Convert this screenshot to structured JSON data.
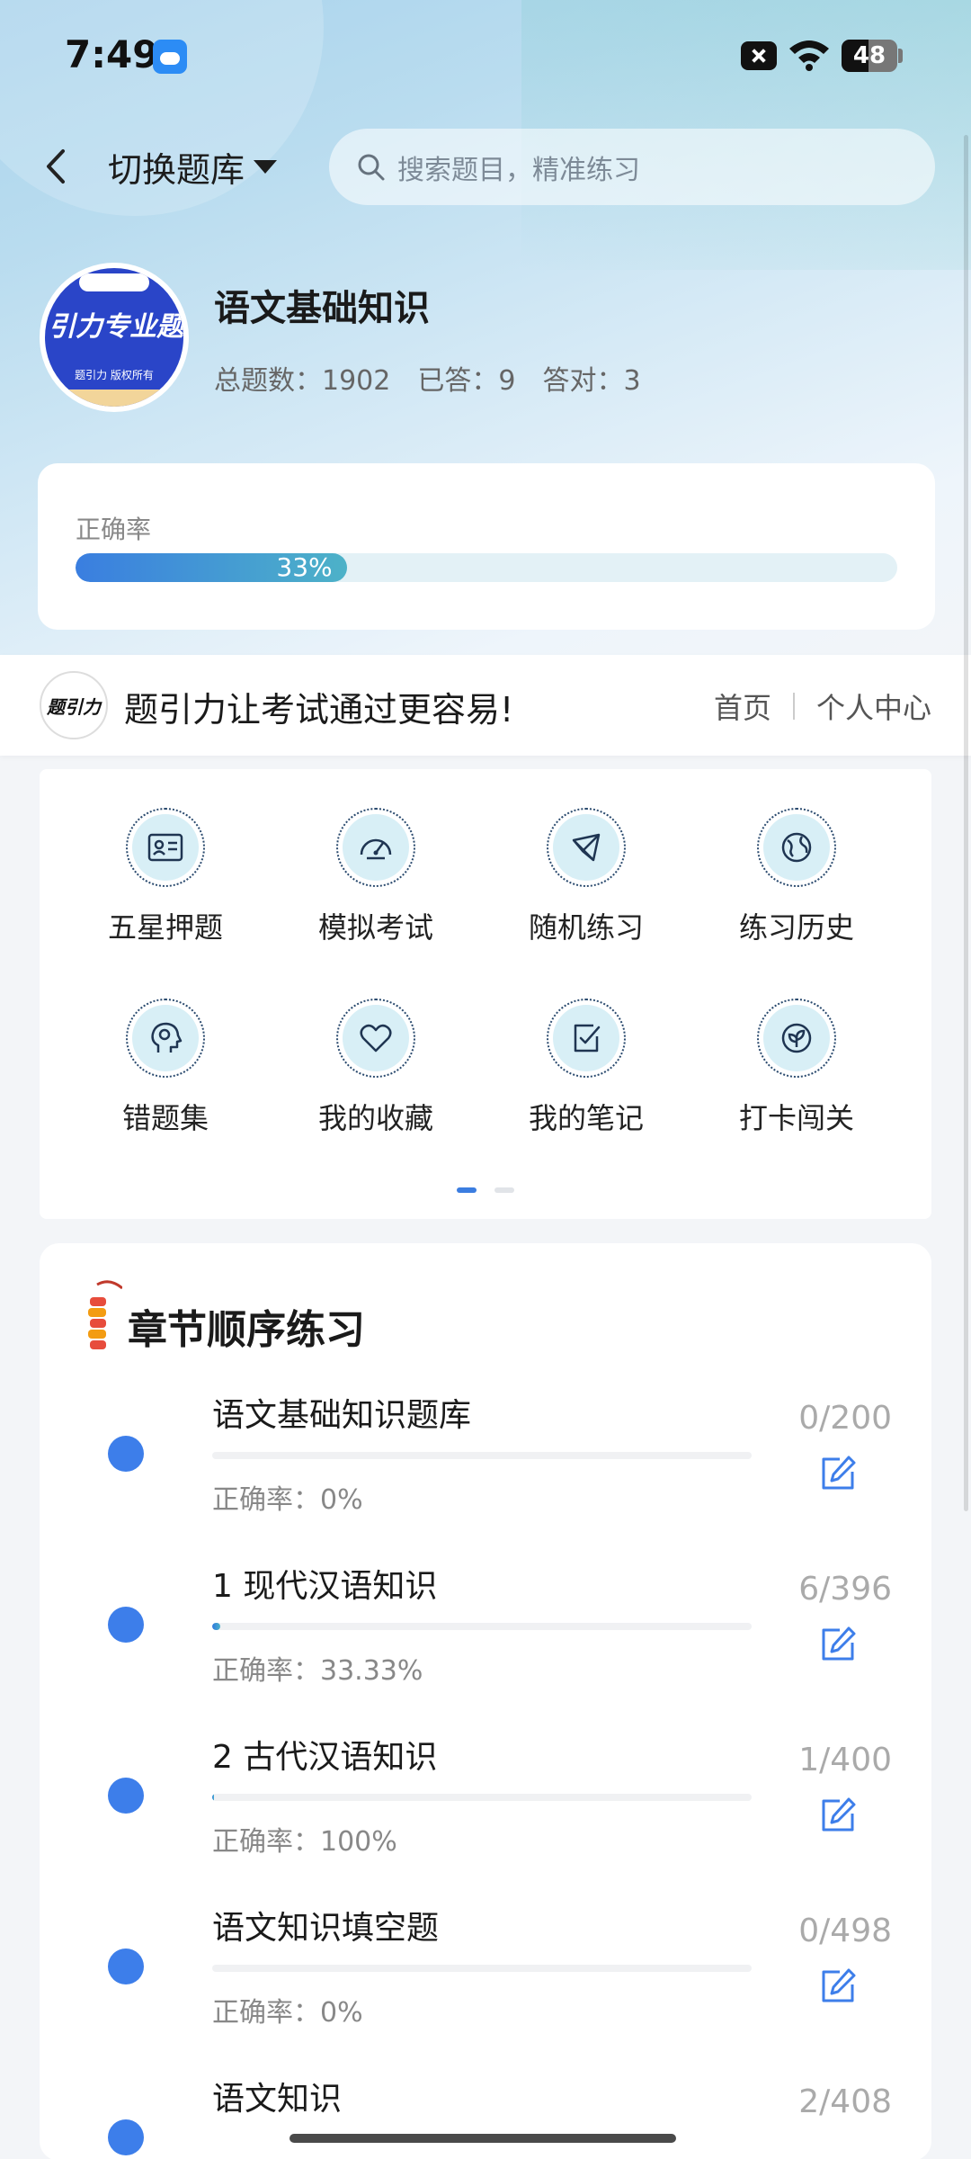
{
  "status_bar": {
    "time": "7:49",
    "battery": "48"
  },
  "header": {
    "switch_label": "切换题库",
    "search_placeholder": "搜索题目，精准练习"
  },
  "bank": {
    "logo_title": "引力专业题",
    "logo_subtitle": "题引力 版权所有",
    "logo_pill": "题引力",
    "title": "语文基础知识",
    "total": "总题数：1902",
    "answered": "已答：9",
    "correct": "答对：3"
  },
  "accuracy": {
    "label": "正确率",
    "value_text": "33%",
    "value": 0.33
  },
  "slogan": {
    "logo_text": "题引力",
    "text": "题引力让考试通过更容易!",
    "nav_home": "首页",
    "nav_profile": "个人中心"
  },
  "features": [
    {
      "label": "五星押题",
      "icon": "id-card-icon"
    },
    {
      "label": "模拟考试",
      "icon": "gauge-icon"
    },
    {
      "label": "随机练习",
      "icon": "shuffle-icon"
    },
    {
      "label": "练习历史",
      "icon": "globe-icon"
    },
    {
      "label": "错题集",
      "icon": "head-icon"
    },
    {
      "label": "我的收藏",
      "icon": "heart-icon"
    },
    {
      "label": "我的笔记",
      "icon": "note-check-icon"
    },
    {
      "label": "打卡闯关",
      "icon": "leaf-badge-icon"
    }
  ],
  "chapters": {
    "title": "章节顺序练习",
    "items": [
      {
        "name": "语文基础知识题库",
        "accuracy": "正确率：0%",
        "count": "0/200",
        "progress": 0.0
      },
      {
        "name": "1 现代汉语知识",
        "accuracy": "正确率：33.33%",
        "count": "6/396",
        "progress": 0.015
      },
      {
        "name": "2 古代汉语知识",
        "accuracy": "正确率：100%",
        "count": "1/400",
        "progress": 0.0025
      },
      {
        "name": "语文知识填空题",
        "accuracy": "正确率：0%",
        "count": "0/498",
        "progress": 0.0
      },
      {
        "name": "语文知识",
        "accuracy": "",
        "count": "2/408",
        "progress": 0.005
      }
    ]
  },
  "colors": {
    "accent": "#3d7eea",
    "icon_stroke": "#2a4a6e",
    "icon_bg": "#d8eff6"
  }
}
